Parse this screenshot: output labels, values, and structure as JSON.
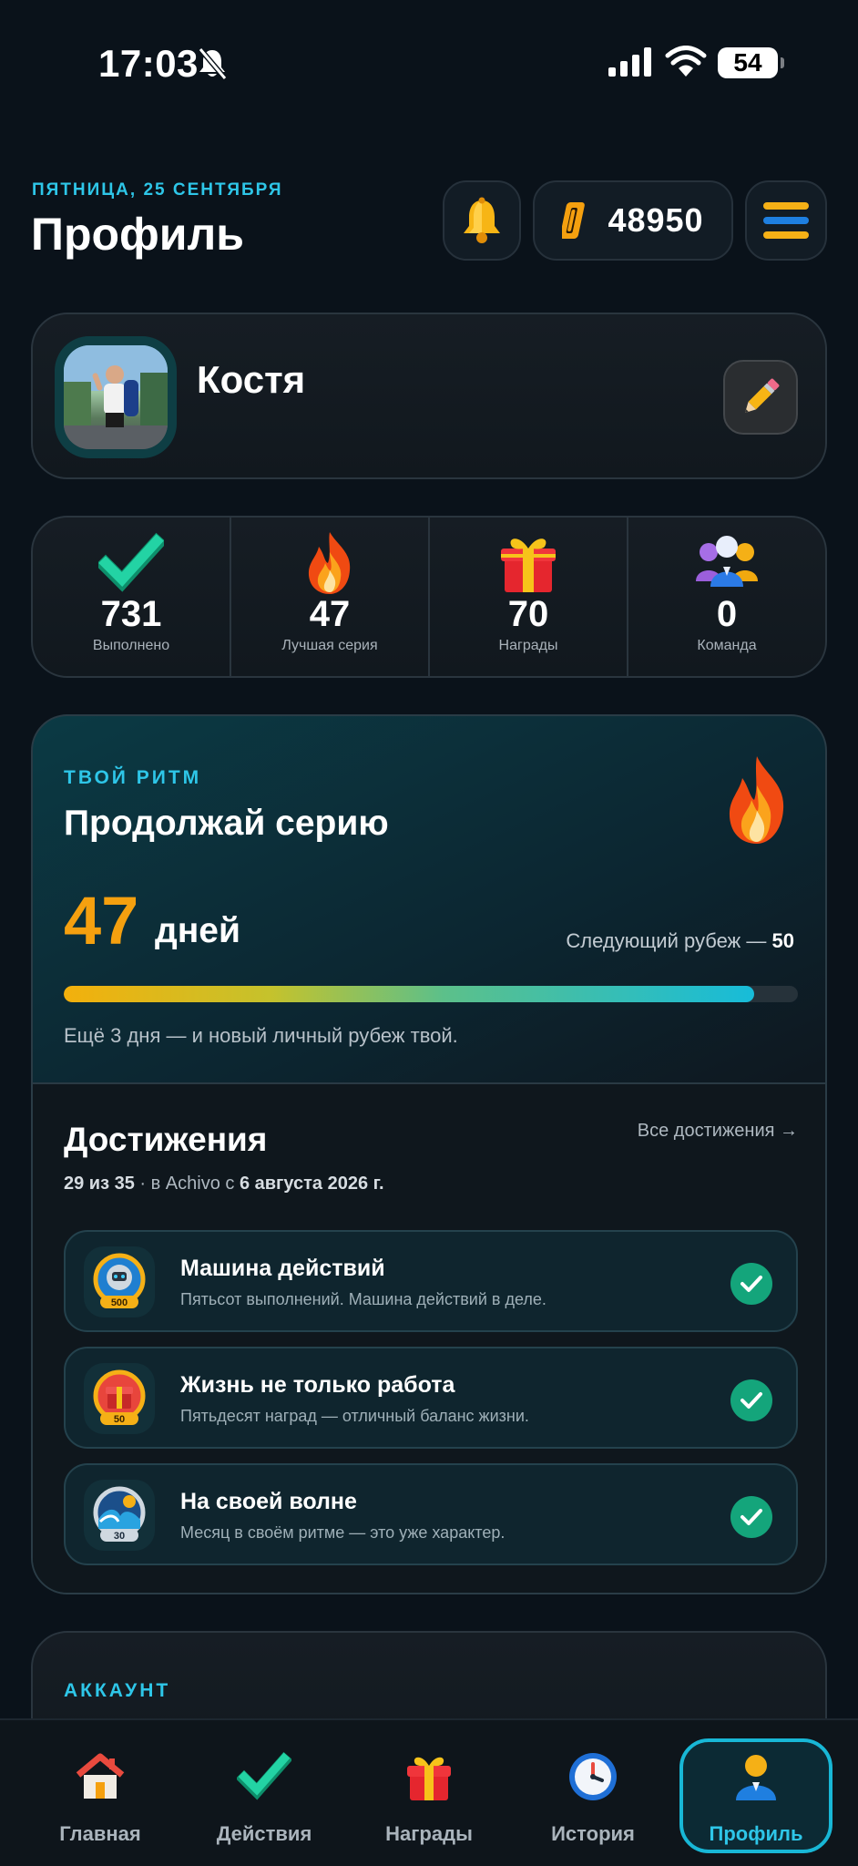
{
  "status_bar": {
    "time": "17:03",
    "battery": "54"
  },
  "header": {
    "date": "ПЯТНИЦА, 25 СЕНТЯБРЯ",
    "title": "Профиль",
    "coins": "48950"
  },
  "profile": {
    "name": "Костя"
  },
  "stats": [
    {
      "value": "731",
      "label": "Выполнено",
      "icon": "checkmark-icon"
    },
    {
      "value": "47",
      "label": "Лучшая серия",
      "icon": "flame-icon"
    },
    {
      "value": "70",
      "label": "Награды",
      "icon": "gift-icon"
    },
    {
      "value": "0",
      "label": "Команда",
      "icon": "team-icon"
    }
  ],
  "rhythm": {
    "kicker": "ТВОЙ РИТМ",
    "title": "Продолжай серию",
    "days": "47",
    "unit": "дней",
    "next_label": "Следующий рубеж —",
    "next_value": "50",
    "progress": 0.94,
    "hint": "Ещё 3 дня — и новый личный рубеж твой."
  },
  "achievements": {
    "title": "Достижения",
    "all_link": "Все достижения →",
    "count": "29 из 35",
    "since_prefix": "· в Achivo с",
    "since_date": "6 августа 2026 г.",
    "items": [
      {
        "name": "Машина действий",
        "desc": "Пятьсот выполнений. Машина действий в деле.",
        "badge": "500"
      },
      {
        "name": "Жизнь не только работа",
        "desc": "Пятьдесят наград — отличный баланс жизни.",
        "badge": "50"
      },
      {
        "name": "На своей волне",
        "desc": "Месяц в своём ритме — это уже характер.",
        "badge": "30"
      }
    ]
  },
  "account": {
    "kicker": "АККАУНТ"
  },
  "tabs": [
    {
      "label": "Главная",
      "icon": "home-icon"
    },
    {
      "label": "Действия",
      "icon": "checkmark-icon"
    },
    {
      "label": "Награды",
      "icon": "gift-icon"
    },
    {
      "label": "История",
      "icon": "clock-icon"
    },
    {
      "label": "Профиль",
      "icon": "person-icon",
      "active": true
    }
  ],
  "colors": {
    "accent": "#2ec6e8",
    "streak": "#f5a00f",
    "success": "#14a57b",
    "background": "#0a121a"
  }
}
